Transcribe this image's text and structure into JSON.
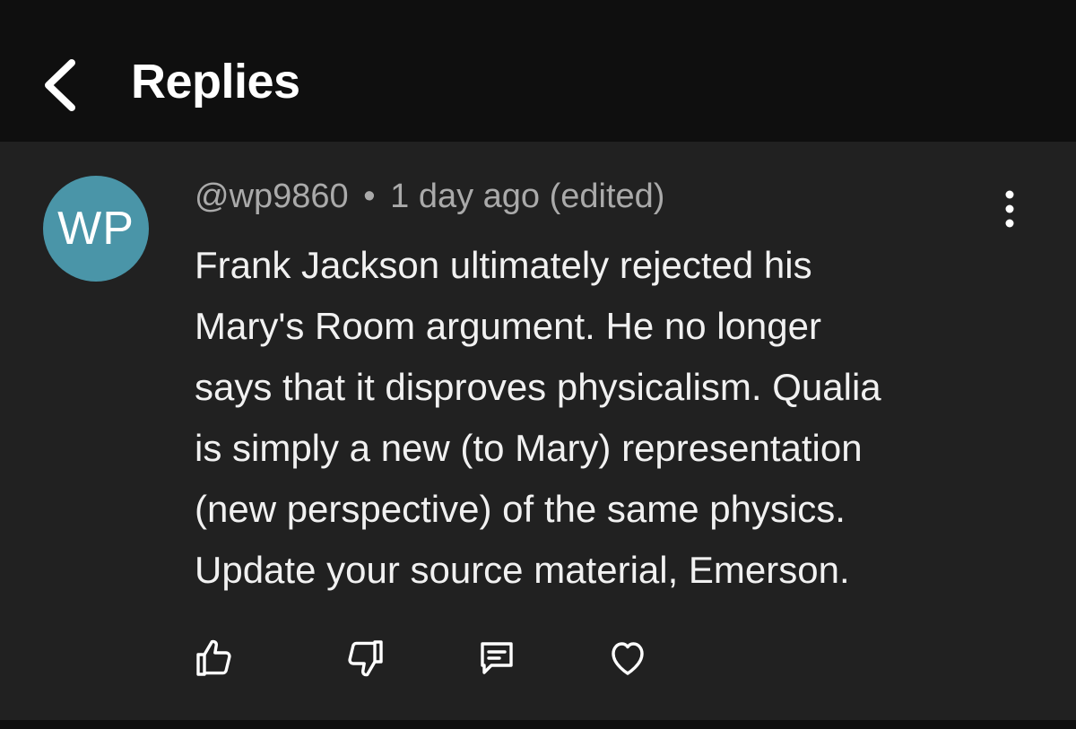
{
  "header": {
    "title": "Replies",
    "back_icon": "chevron-left-icon"
  },
  "comment": {
    "avatar_initials": "WP",
    "avatar_color": "#4a95a8",
    "author": "@wp9860",
    "separator": "•",
    "timestamp": "1 day ago (edited)",
    "text_lines": [
      "Frank Jackson ultimately rejected his",
      "Mary's Room argument. He no longer",
      "says that it disproves physicalism. Qualia",
      "is simply a new (to Mary) representation",
      "(new perspective) of the same physics.",
      "Update your source material, Emerson."
    ],
    "menu_icon": "more-vertical-icon",
    "actions": [
      {
        "name": "like",
        "icon": "thumbs-up-icon"
      },
      {
        "name": "dislike",
        "icon": "thumbs-down-icon"
      },
      {
        "name": "reply",
        "icon": "comment-icon"
      },
      {
        "name": "heart",
        "icon": "heart-icon"
      }
    ]
  },
  "colors": {
    "background": "#0f0f0f",
    "panel": "#212121",
    "text_primary": "#f1f1f1",
    "text_secondary": "#aaaaaa"
  }
}
